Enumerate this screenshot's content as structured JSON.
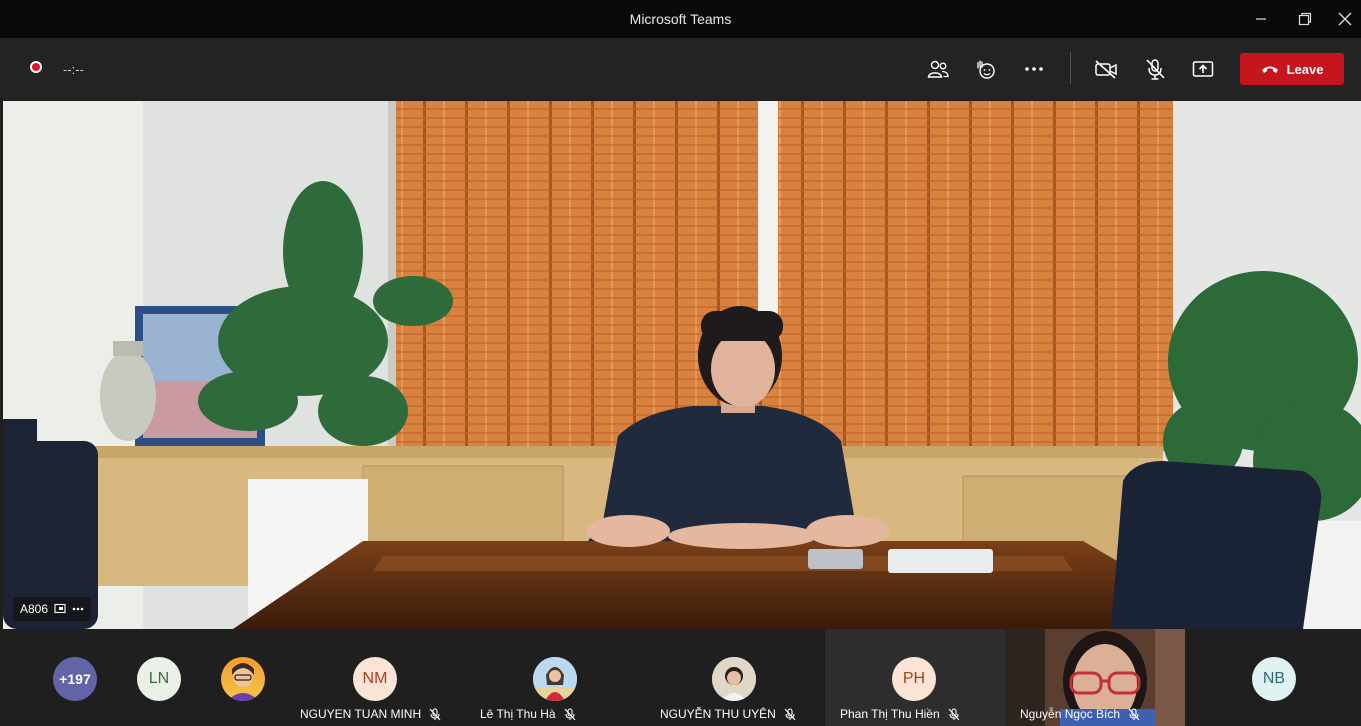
{
  "window": {
    "title": "Microsoft Teams"
  },
  "toolbar": {
    "timer": "--:--",
    "leave_label": "Leave"
  },
  "stage": {
    "speaker_tag": "A806"
  },
  "participants": {
    "overflow": "+197",
    "ln": "LN",
    "nm_initials": "NM",
    "nm_name": "NGUYEN TUAN MINH",
    "ha_name": "Lê Thị Thu Hà",
    "uyen_name": "NGUYỄN THU UYÊN",
    "ph_initials": "PH",
    "ph_name": "Phan Thị Thu Hiền",
    "bich_name": "Nguyễn Ngọc Bích",
    "nb": "NB"
  },
  "colors": {
    "accent_purple": "#6264a7",
    "leave_red": "#c4161c",
    "avatar_bg": "#fbe3d6",
    "avatar_text": "#a0441e"
  }
}
